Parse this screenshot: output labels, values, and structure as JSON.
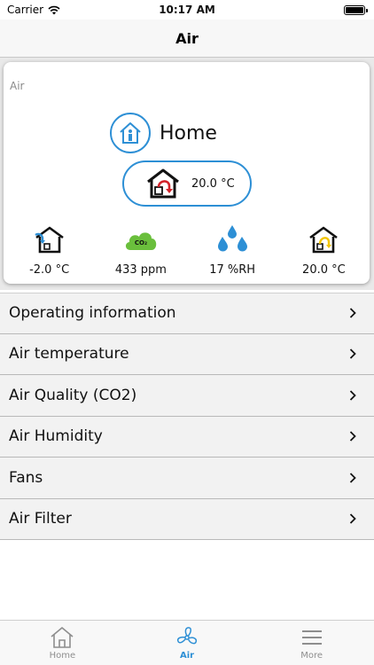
{
  "status_bar": {
    "carrier": "Carrier",
    "time": "10:17 AM"
  },
  "nav": {
    "title": "Air"
  },
  "card": {
    "label": "Air",
    "home_label": "Home",
    "supply_temp": "20.0 °C",
    "metrics": [
      {
        "icon": "outdoor-temp-icon",
        "value": "-2.0 °C"
      },
      {
        "icon": "co2-cloud-icon",
        "value": "433 ppm"
      },
      {
        "icon": "humidity-drops-icon",
        "value": "17 %RH"
      },
      {
        "icon": "exhaust-temp-icon",
        "value": "20.0 °C"
      }
    ]
  },
  "list": [
    {
      "label": "Operating information"
    },
    {
      "label": "Air temperature"
    },
    {
      "label": "Air Quality (CO2)"
    },
    {
      "label": "Air Humidity"
    },
    {
      "label": "Fans"
    },
    {
      "label": "Air Filter"
    }
  ],
  "tabs": [
    {
      "label": "Home",
      "icon": "house-icon"
    },
    {
      "label": "Air",
      "icon": "fan-icon"
    },
    {
      "label": "More",
      "icon": "hamburger-icon"
    }
  ],
  "colors": {
    "accent": "#2d8fd5",
    "co2_green": "#6abf3c",
    "return_red": "#d2232a",
    "yellow": "#f2c500"
  }
}
